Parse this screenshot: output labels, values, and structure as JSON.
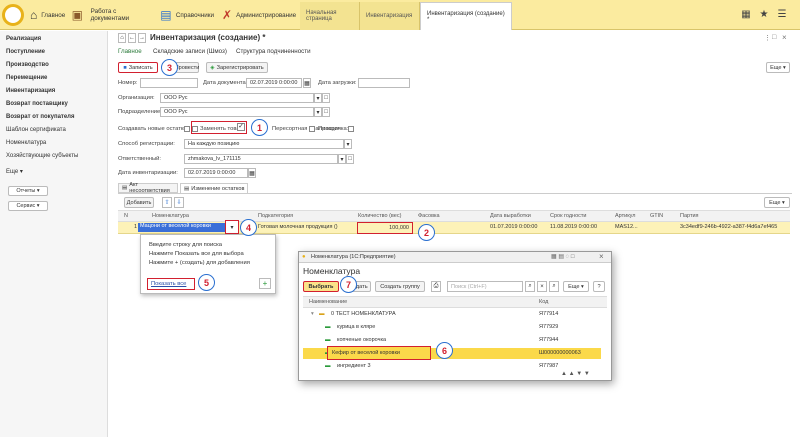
{
  "topbar": {
    "sections": [
      "Главное",
      "Работа с документами",
      "Справочники",
      "Администрирование"
    ],
    "tabs": [
      "Начальная страница",
      "Инвентаризация",
      "Инвентаризация (создание) *"
    ]
  },
  "sidebar": {
    "items": [
      "Реализация",
      "Поступление",
      "Производство",
      "Перемещение",
      "Инвентаризация",
      "Возврат поставщику",
      "Возврат от покупателя",
      "Шаблон сертификата",
      "Номенклатура",
      "Хозяйствующие субъекты",
      "Еще ▾"
    ],
    "buttons": [
      "Отчеты ▾",
      "Сервис ▾"
    ]
  },
  "doc": {
    "title": "Инвентаризация (создание) *",
    "subtabs": [
      "Главное",
      "Складские записи (Шмоз)",
      "Структура подчиненности"
    ],
    "toolbar": {
      "save": "Записать",
      "post": "Провести",
      "register": "Зарегистрировать",
      "more": "Еще ▾"
    },
    "number_label": "Номер:",
    "date_label": "Дата документа:",
    "date_value": "02.07.2019  0:00:00",
    "load_label": "Дата загрузки:",
    "org_label": "Организация:",
    "org_value": "ООО Рус",
    "div_label": "Подразделение:",
    "div_value": "ООО Рус",
    "create_label": "Создавать новые остатки",
    "replace_label": "Заменять товар",
    "sale_label": "Пересортная реализация",
    "overdue_label": "Просрочка:",
    "reg_label": "Способ регистрации:",
    "reg_value": "На каждую позицию",
    "resp_label": "Ответственный:",
    "resp_value": "zhmakova_lv_171115",
    "inv_date_label": "Дата инвентаризации:",
    "inv_date_value": "02.07.2019  0:00:00",
    "tabs2": [
      "Акт несоответствия",
      "Изменение остатков"
    ],
    "add": "Добавить"
  },
  "table": {
    "headers": [
      "N",
      "Номенклатура",
      "Подкатегория",
      "Количество (вес)",
      "Фасовка",
      "Дата выработки",
      "Срок годности",
      "Артикул",
      "GTIN",
      "Партия"
    ],
    "row": {
      "n": "1",
      "nom": "Мацони от веселой коровки",
      "sub": "Готовая молочная продукция ()",
      "qty": "100,000",
      "pack": "",
      "made": "01.07.2019  0:00:00",
      "exp": "11.08.2019  0:00:00",
      "art": "MAS12...",
      "gtin": "",
      "batch": "3c34edf9-246b-4922-a387-f4d6a7ef465"
    }
  },
  "dropdown": {
    "lines": [
      "Введите строку для поиска",
      "Нажмите Показать все для выбора",
      "Нажмите + (создать) для добавления"
    ],
    "show_all": "Показать все",
    "plus": "+"
  },
  "dialog": {
    "window_title": "Номенклатура (1С:Предприятие)",
    "title": "Номенклатура",
    "select": "Выбрать",
    "create": "Создать",
    "create_group": "Создать группу",
    "search_placeholder": "Поиск (Ctrl+F)",
    "more": "Еще ▾",
    "help": "?",
    "headers": [
      "Наименование",
      "Код"
    ],
    "rows": [
      {
        "name": "0 ТЕСТ НОМЕНКЛАТУРА",
        "code": "Я77914"
      },
      {
        "name": "курица в кляре",
        "code": "Я77929"
      },
      {
        "name": "копченые окорочка",
        "code": "Я77944"
      },
      {
        "name": "Кефир от веселой коровки",
        "code": "Ш000000000063"
      },
      {
        "name": "ингредиент 3",
        "code": "Я77987"
      }
    ]
  },
  "markers": [
    "1",
    "2",
    "3",
    "4",
    "5",
    "6",
    "7"
  ],
  "colors": {
    "accent": "#d2202f",
    "topbar": "#fbeb9f",
    "selected_row": "#fdf2b8",
    "badge_border": "#2a6fd0"
  }
}
